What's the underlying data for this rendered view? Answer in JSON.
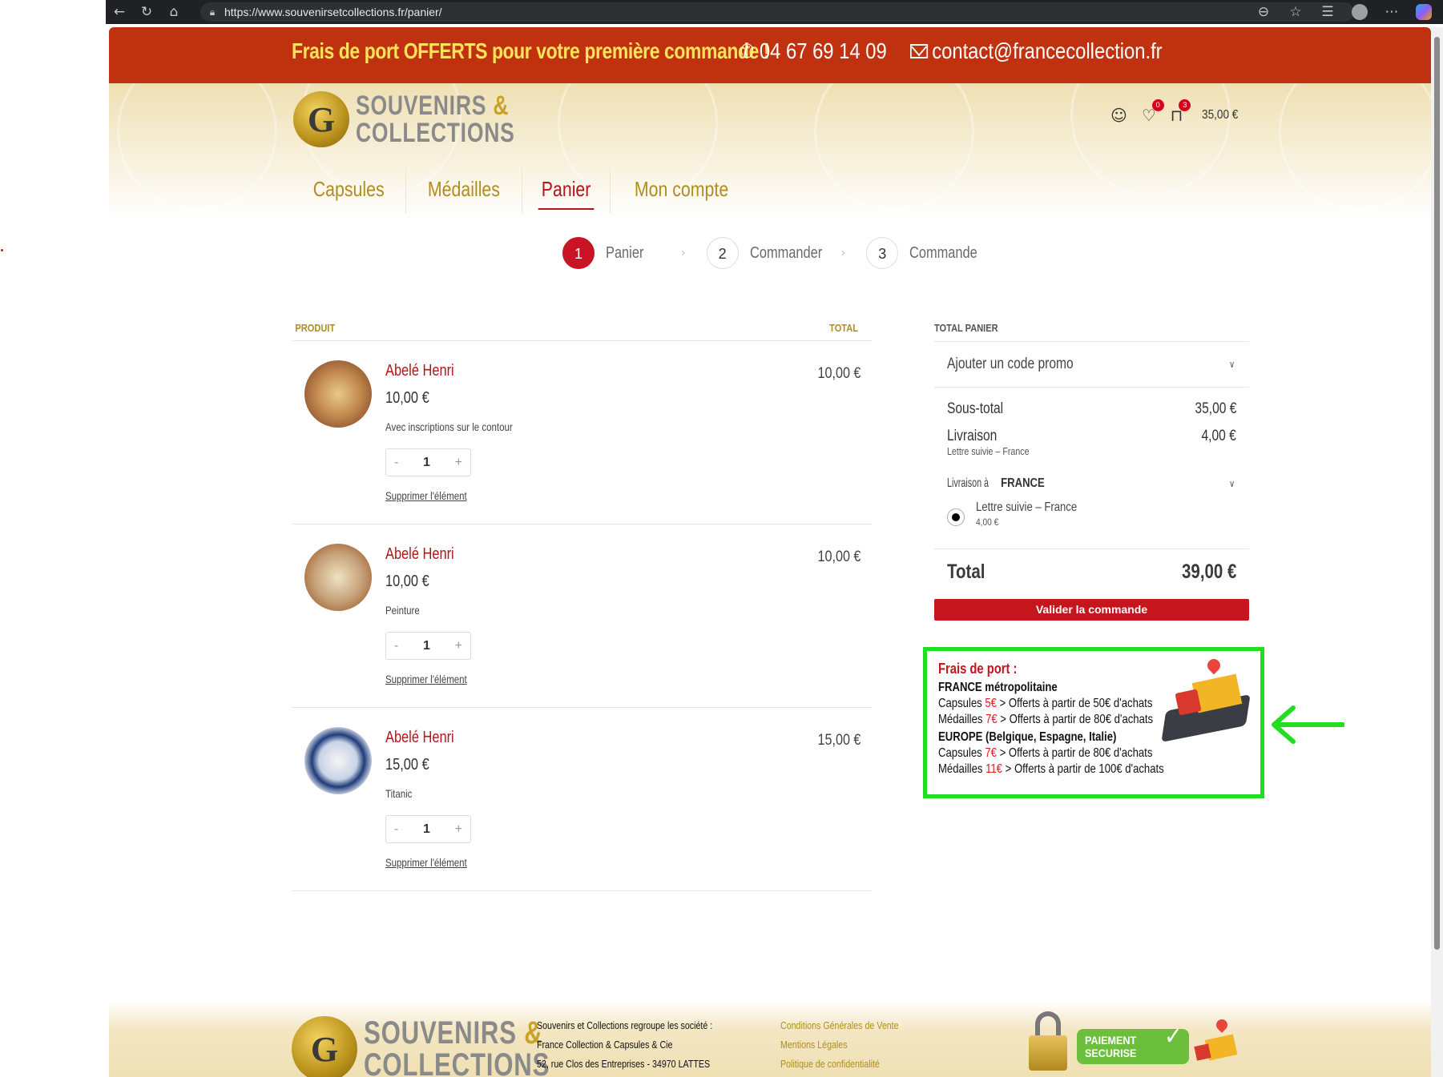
{
  "browser": {
    "url": "https://www.souvenirsetcollections.fr/panier/",
    "icons": [
      "back-icon",
      "reload-icon",
      "home-icon",
      "lock-icon",
      "reader-icon",
      "star-icon",
      "favorites-icon",
      "profile-icon",
      "more-icon",
      "copilot-icon"
    ]
  },
  "topbar": {
    "promo": "Frais de port OFFERTS pour votre première commande !",
    "phone": "04 67 69 14 09",
    "email": "contact@francecollection.fr"
  },
  "header": {
    "logo_line1": "SOUVENIRS",
    "logo_amp": "&",
    "logo_line2": "COLLECTIONS",
    "logo_letter": "G",
    "wishlist_count": "0",
    "cart_count": "3",
    "cart_total": "35,00 €"
  },
  "nav": {
    "items": [
      {
        "label": "Capsules"
      },
      {
        "label": "Médailles"
      },
      {
        "label": "Panier"
      },
      {
        "label": "Mon compte"
      }
    ]
  },
  "steps": [
    {
      "num": "1",
      "label": "Panier"
    },
    {
      "num": "2",
      "label": "Commander"
    },
    {
      "num": "3",
      "label": "Commande"
    }
  ],
  "cart": {
    "col_product": "PRODUIT",
    "col_total": "TOTAL",
    "items": [
      {
        "name": "Abelé Henri",
        "price": "10,00 €",
        "desc": "Avec inscriptions sur le contour",
        "qty": "1",
        "remove": "Supprimer l'élément",
        "total": "10,00 €"
      },
      {
        "name": "Abelé Henri",
        "price": "10,00 €",
        "desc": "Peinture",
        "qty": "1",
        "remove": "Supprimer l'élément",
        "total": "10,00 €"
      },
      {
        "name": "Abelé Henri",
        "price": "15,00 €",
        "desc": "Titanic",
        "qty": "1",
        "remove": "Supprimer l'élément",
        "total": "15,00 €"
      }
    ],
    "qty_minus": "-",
    "qty_plus": "+"
  },
  "totals": {
    "title": "TOTAL PANIER",
    "promo_label": "Ajouter un code promo",
    "subtotal_label": "Sous-total",
    "subtotal_value": "35,00 €",
    "shipping_label": "Livraison",
    "shipping_value": "4,00 €",
    "shipping_method": "Lettre suivie – France",
    "ship_to_label": "Livraison à",
    "ship_to_country": "FRANCE",
    "option_label": "Lettre suivie – France",
    "option_price": "4,00 €",
    "total_label": "Total",
    "total_value": "39,00 €",
    "validate_label": "Valider la commande"
  },
  "shipping_info": {
    "heading": "Frais de port :",
    "france_title": "FRANCE métropolitaine",
    "france_lines": [
      {
        "pre": "Capsules ",
        "price": "5€",
        "post": " > Offerts à partir de 50€ d'achats"
      },
      {
        "pre": "Médailles ",
        "price": "7€",
        "post": " > Offerts à partir de 80€ d'achats"
      }
    ],
    "europe_title": "EUROPE (Belgique, Espagne, Italie)",
    "europe_lines": [
      {
        "pre": "Capsules ",
        "price": "7€",
        "post": " > Offerts à partir de 80€ d'achats"
      },
      {
        "pre": "Médailles ",
        "price": "11€",
        "post": " > Offerts à partir de 100€ d'achats"
      }
    ]
  },
  "footer": {
    "company_lines": [
      "Souvenirs et Collections regroupe les société :",
      "France Collection & Capsules & Cie",
      "52, rue Clos des Entreprises - 34970 LATTES"
    ],
    "links": [
      "Conditions Générales de Vente",
      "Mentions Légales",
      "Politique de confidentialité"
    ],
    "pay_line1": "PAIEMENT",
    "pay_line2": "SECURISE"
  },
  "colors": {
    "topbar": "#c0310f",
    "gold": "#b08d1e",
    "red": "#c4161c",
    "highlight": "#22dd22"
  }
}
